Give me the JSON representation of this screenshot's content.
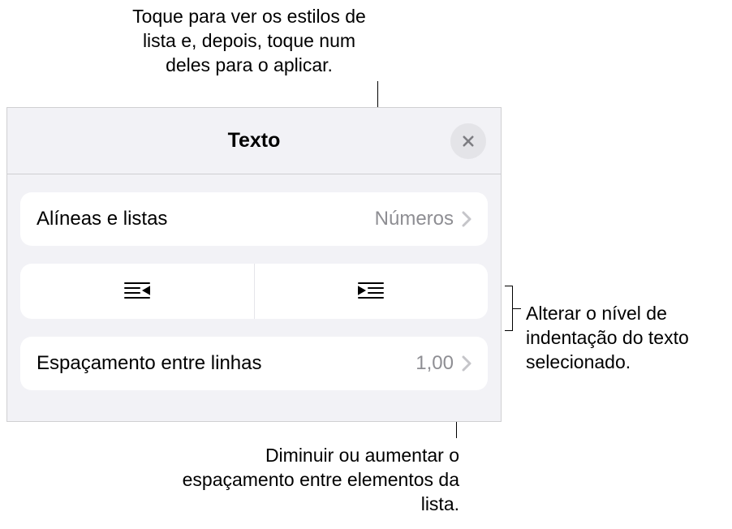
{
  "callouts": {
    "top": "Toque para ver os estilos de lista e, depois, toque num deles para o aplicar.",
    "right": "Alterar o nível de indentação do texto selecionado.",
    "bottom": "Diminuir ou aumentar o espaçamento entre elementos da lista."
  },
  "panel": {
    "title": "Texto",
    "bullets_lists": {
      "label": "Alíneas e listas",
      "value": "Números"
    },
    "line_spacing": {
      "label": "Espaçamento entre linhas",
      "value": "1,00"
    }
  }
}
